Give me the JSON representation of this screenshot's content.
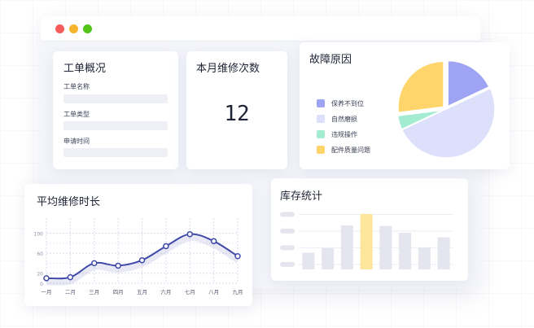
{
  "window": {
    "controls": [
      "close-dot",
      "minimize-dot",
      "maximize-dot"
    ]
  },
  "overview": {
    "title": "工单概况",
    "fields": [
      {
        "label": "工单名称"
      },
      {
        "label": "工单类型"
      },
      {
        "label": "申请时间"
      }
    ]
  },
  "repair_count": {
    "title": "本月维修次数",
    "value": "12"
  },
  "fault": {
    "title": "故障原因"
  },
  "avg_time": {
    "title": "平均维修时长"
  },
  "stock": {
    "title": "库存统计"
  },
  "colors": {
    "accent": "#3f4aa8",
    "purple": "#9ea3f3",
    "lavender": "#dde0fb",
    "mint": "#a3ecd1",
    "yellow": "#fdd56b",
    "bar_gray": "#e4e5ef",
    "bar_highlight": "#fde59c"
  },
  "chart_data": [
    {
      "type": "pie",
      "title": "故障原因",
      "legend_position": "left",
      "categories": [
        "保养不到位",
        "自然磨损",
        "违规操作",
        "配件质量问题"
      ],
      "values": [
        18,
        50,
        5,
        27
      ],
      "colors": [
        "#9ea3f3",
        "#dde0fb",
        "#a3ecd1",
        "#fdd56b"
      ]
    },
    {
      "type": "line",
      "title": "平均维修时长",
      "categories": [
        "一月",
        "二月",
        "三月",
        "四月",
        "五月",
        "六月",
        "七月",
        "八月",
        "九月"
      ],
      "y_ticks": [
        "0",
        "20",
        "60",
        "100"
      ],
      "values": [
        10,
        12,
        40,
        35,
        46,
        74,
        98,
        84,
        54
      ],
      "ylim": [
        0,
        130
      ],
      "grid": true
    },
    {
      "type": "bar",
      "title": "库存统计",
      "values": [
        25,
        32,
        66,
        83,
        65,
        55,
        33,
        48
      ],
      "highlight_index": 3,
      "ylim": [
        0,
        100
      ],
      "grid": true
    }
  ]
}
